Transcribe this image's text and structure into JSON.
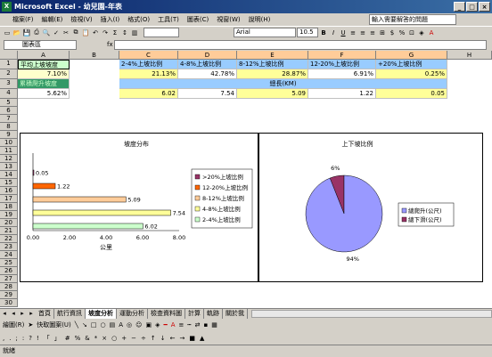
{
  "window": {
    "title": "Microsoft Excel - 幼兒園-年表",
    "controls": [
      "_",
      "□",
      "×"
    ]
  },
  "menu": [
    "檔案(F)",
    "編輯(E)",
    "檢視(V)",
    "插入(I)",
    "格式(O)",
    "工具(T)",
    "圖表(C)",
    "視窗(W)",
    "說明(H)"
  ],
  "help_placeholder": "輸入需要解答的問題",
  "toolbar": {
    "font": "Arial",
    "size": "10.5"
  },
  "formula": {
    "namebox": "圖表區",
    "fx": "fx"
  },
  "columns": [
    "A",
    "B",
    "C",
    "D",
    "E",
    "F",
    "G",
    "H"
  ],
  "rows": [
    "1",
    "2",
    "3",
    "4",
    "5",
    "6",
    "7",
    "8",
    "9",
    "10",
    "11",
    "12",
    "13",
    "14",
    "15",
    "16",
    "17",
    "18",
    "19",
    "20",
    "21",
    "22",
    "23",
    "24",
    "25",
    "26",
    "27",
    "28",
    "29",
    "30"
  ],
  "cells": {
    "a1": "平均上坡坡度",
    "a2": "7.10%",
    "a3": "累積爬升坡度",
    "a4": "5.62%",
    "c1": "2-4%上坡比例",
    "d1": "4-8%上坡比例",
    "e1": "8-12%上坡比例",
    "f1": "12-20%上坡比例",
    "g1": "+20%上坡比例",
    "c2": "21.13%",
    "d2": "42.78%",
    "e2": "28.87%",
    "f2": "6.91%",
    "g2": "0.25%",
    "c3": "總長(KM)",
    "c4": "6.02",
    "d4": "7.54",
    "e4": "5.09",
    "f4": "1.22",
    "g4": "0.05"
  },
  "colors": {
    "selected_header": "#ffcc99",
    "bar_fill": "#ffff99",
    "pie_main": "#9999ff",
    "pie_small": "#993366",
    "sheet_bg": "#ffffff"
  },
  "chart_data": [
    {
      "type": "bar",
      "title": "坡度分布",
      "xlabel": "公里",
      "categories": [
        "2-4%上坡比例",
        "4-8%上坡比例",
        "8-12%上坡比例",
        "12-20%上坡比例",
        ">20%上坡比例"
      ],
      "values": [
        6.02,
        7.54,
        5.09,
        1.22,
        0.05
      ],
      "data_labels": [
        "6.02",
        "7.54",
        "5.09",
        "1.22",
        "0.05"
      ],
      "colors": [
        "#ccffcc",
        "#ffff99",
        "#ffcc99",
        "#ff6600",
        "#993366"
      ],
      "xlim": [
        0,
        8
      ],
      "ticks": [
        "0.00",
        "2.00",
        "4.00",
        "6.00",
        "8.00"
      ],
      "legend": [
        ">20%上坡比例",
        "12-20%上坡比例",
        "8-12%上坡比例",
        "4-8%上坡比例",
        "2-4%上坡比例"
      ],
      "legend_colors": [
        "#993366",
        "#ff6600",
        "#ffcc99",
        "#ffff99",
        "#ccffcc"
      ]
    },
    {
      "type": "pie",
      "title": "上下坡比例",
      "categories": [
        "總爬升(公尺)",
        "總下滑(公尺)"
      ],
      "values": [
        94,
        6
      ],
      "data_labels": [
        "94%",
        "6%"
      ],
      "colors": [
        "#9999ff",
        "#993366"
      ]
    }
  ],
  "sheets": [
    "首頁",
    "航行資訊",
    "坡度分析",
    "運動分析",
    "檢查資料圖",
    "計算",
    "軌跡",
    "關於我"
  ],
  "active_sheet": "坡度分析",
  "draw": {
    "label": "繪圖(R)",
    "autoshape": "快取圖案(U)"
  },
  "status": "就緒"
}
